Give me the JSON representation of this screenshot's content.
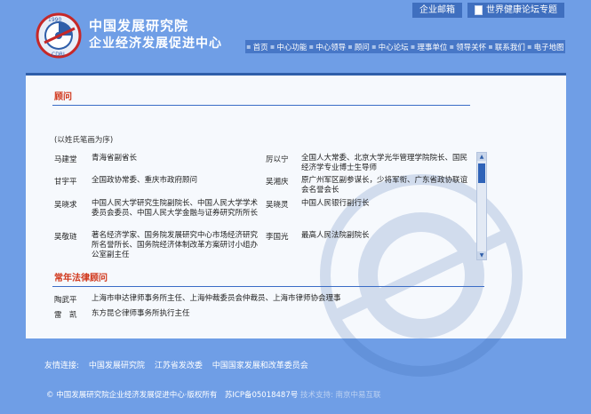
{
  "header": {
    "logo_ring_year": "1990",
    "logo_ring_text": "CDRI",
    "title_line1": "中国发展研究院",
    "title_line2": "企业经济发展促进中心",
    "top_links": [
      {
        "label": "企业邮箱"
      },
      {
        "label": "世界健康论坛专题"
      }
    ],
    "nav": [
      "首页",
      "中心功能",
      "中心领导",
      "顾问",
      "中心论坛",
      "理事单位",
      "领导关怀",
      "联系我们",
      "电子地图"
    ]
  },
  "advisors": {
    "section_title": "顾问",
    "note": "(以姓氏笔画为序)",
    "left": [
      {
        "name": "马建堂",
        "title": "青海省副省长"
      },
      {
        "name": "甘宇平",
        "title": "全国政协常委、重庆市政府顾问"
      },
      {
        "name": "吴晓求",
        "title": "中国人民大学研究生院副院长、中国人民大学学术委员会委员、中国人民大学金融与证券研究所所长"
      },
      {
        "name": "吴敬琏",
        "title": "著名经济学家、国务院发展研究中心市场经济研究所名誉所长、国务院经济体制改革方案研讨小组办公室副主任"
      }
    ],
    "right": [
      {
        "name": "厉以宁",
        "title": "全国人大常委、北京大学光华管理学院院长、国民经济学专业博士生导师"
      },
      {
        "name": "吴湘庆",
        "title": "原广州军区副参谋长，少将军衔、广东省政协联谊会名誉会长"
      },
      {
        "name": "吴晓灵",
        "title": "中国人民银行副行长"
      },
      {
        "name": "李国光",
        "title": "最高人民法院副院长"
      }
    ]
  },
  "legal": {
    "section_title": "常年法律顾问",
    "items": [
      {
        "name": "陶武平",
        "title": "上海市申达律师事务所主任、上海仲裁委员会仲裁员、上海市律师协会理事"
      },
      {
        "name": "雷　凯",
        "title": "东方昆仑律师事务所执行主任"
      }
    ]
  },
  "footer": {
    "links_label": "友情连接:",
    "links": [
      "中国发展研究院",
      "江苏省发改委",
      "中国国家发展和改革委员会"
    ],
    "copyright": "© 中国发展研究院企业经济发展促进中心·版权所有　苏ICP备05018487号",
    "tech_support": "技术支持: 南京中易互联"
  },
  "colors": {
    "background": "#6f9ee6",
    "nav_bar": "#4777c7",
    "panel": "#f6f9fd",
    "section_title": "#d0361a",
    "rule": "#3a6cc6"
  }
}
